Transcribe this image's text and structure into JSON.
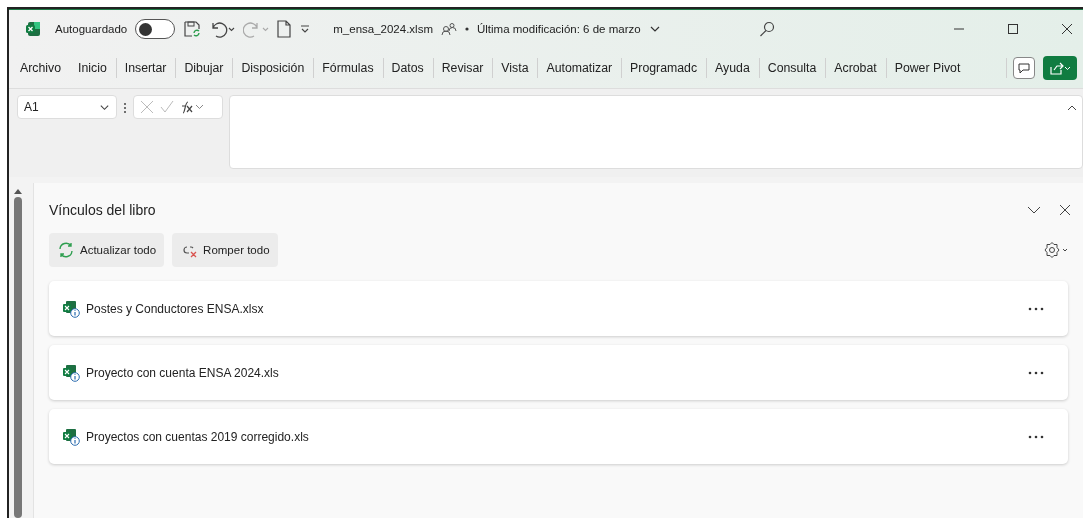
{
  "title_bar": {
    "autosave_label": "Autoguardado",
    "autosave_on": false,
    "file_name": "m_ensa_2024.xlsm",
    "modified": "Última modificación: 6 de marzo"
  },
  "ribbon_tabs": [
    "Archivo",
    "Inicio",
    "Insertar",
    "Dibujar",
    "Disposición",
    "Fórmulas",
    "Datos",
    "Revisar",
    "Vista",
    "Automatizar",
    "Programadc",
    "Ayuda",
    "Consulta",
    "Acrobat",
    "Power Pivot"
  ],
  "formula_bar": {
    "name_box": "A1"
  },
  "panel": {
    "title": "Vínculos del libro",
    "actions": [
      "Actualizar todo",
      "Romper todo"
    ],
    "links": [
      {
        "name": "Postes y Conductores ENSA.xlsx"
      },
      {
        "name": "Proyecto con cuenta ENSA 2024.xls"
      },
      {
        "name": "Proyectos con cuentas 2019 corregido.xls"
      }
    ]
  }
}
